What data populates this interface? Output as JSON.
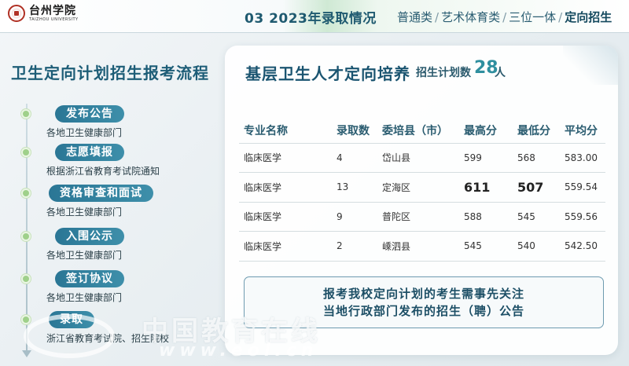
{
  "header": {
    "logo_cn": "台州学院",
    "logo_en": "TAIZHOU UNIVERSITY",
    "section_title": "03 2023年录取情况",
    "nav": [
      {
        "label": "普通类"
      },
      {
        "label": "艺术体育类"
      },
      {
        "label": "三位一体"
      },
      {
        "label": "定向招生",
        "active": true
      }
    ],
    "nav_separator": "/"
  },
  "left": {
    "title": "卫生定向计划招生报考流程",
    "steps": [
      {
        "label": "发布公告",
        "desc": "各地卫生健康部门"
      },
      {
        "label": "志愿填报",
        "desc": "根据浙江省教育考试院通知"
      },
      {
        "label": "资格审查和面试",
        "desc": "各地卫生健康部门"
      },
      {
        "label": "入围公示",
        "desc": "各地卫生健康部门"
      },
      {
        "label": "签订协议",
        "desc": "各地卫生健康部门"
      },
      {
        "label": "录取",
        "desc": "浙江省教育考试院、招生院校"
      }
    ]
  },
  "card": {
    "title": "基层卫生人才定向培养",
    "plan_label": "招生计划数",
    "plan_count": "28",
    "plan_unit": "人",
    "table": {
      "headers": [
        "专业名称",
        "录取数",
        "委培县（市）",
        "最高分",
        "最低分",
        "平均分"
      ],
      "rows": [
        [
          "临床医学",
          "4",
          "岱山县",
          "599",
          "568",
          "583.00"
        ],
        [
          "临床医学",
          "13",
          "定海区",
          "611",
          "507",
          "559.54"
        ],
        [
          "临床医学",
          "9",
          "普陀区",
          "588",
          "545",
          "559.56"
        ],
        [
          "临床医学",
          "2",
          "嵊泗县",
          "545",
          "540",
          "542.50"
        ]
      ]
    },
    "notice": [
      "报考我校定向计划的考生需事先关注",
      "当地行政部门发布的招生（聘）公告"
    ]
  },
  "watermark": {
    "cn": "中国教育在线",
    "en": "www.eol.cn"
  }
}
